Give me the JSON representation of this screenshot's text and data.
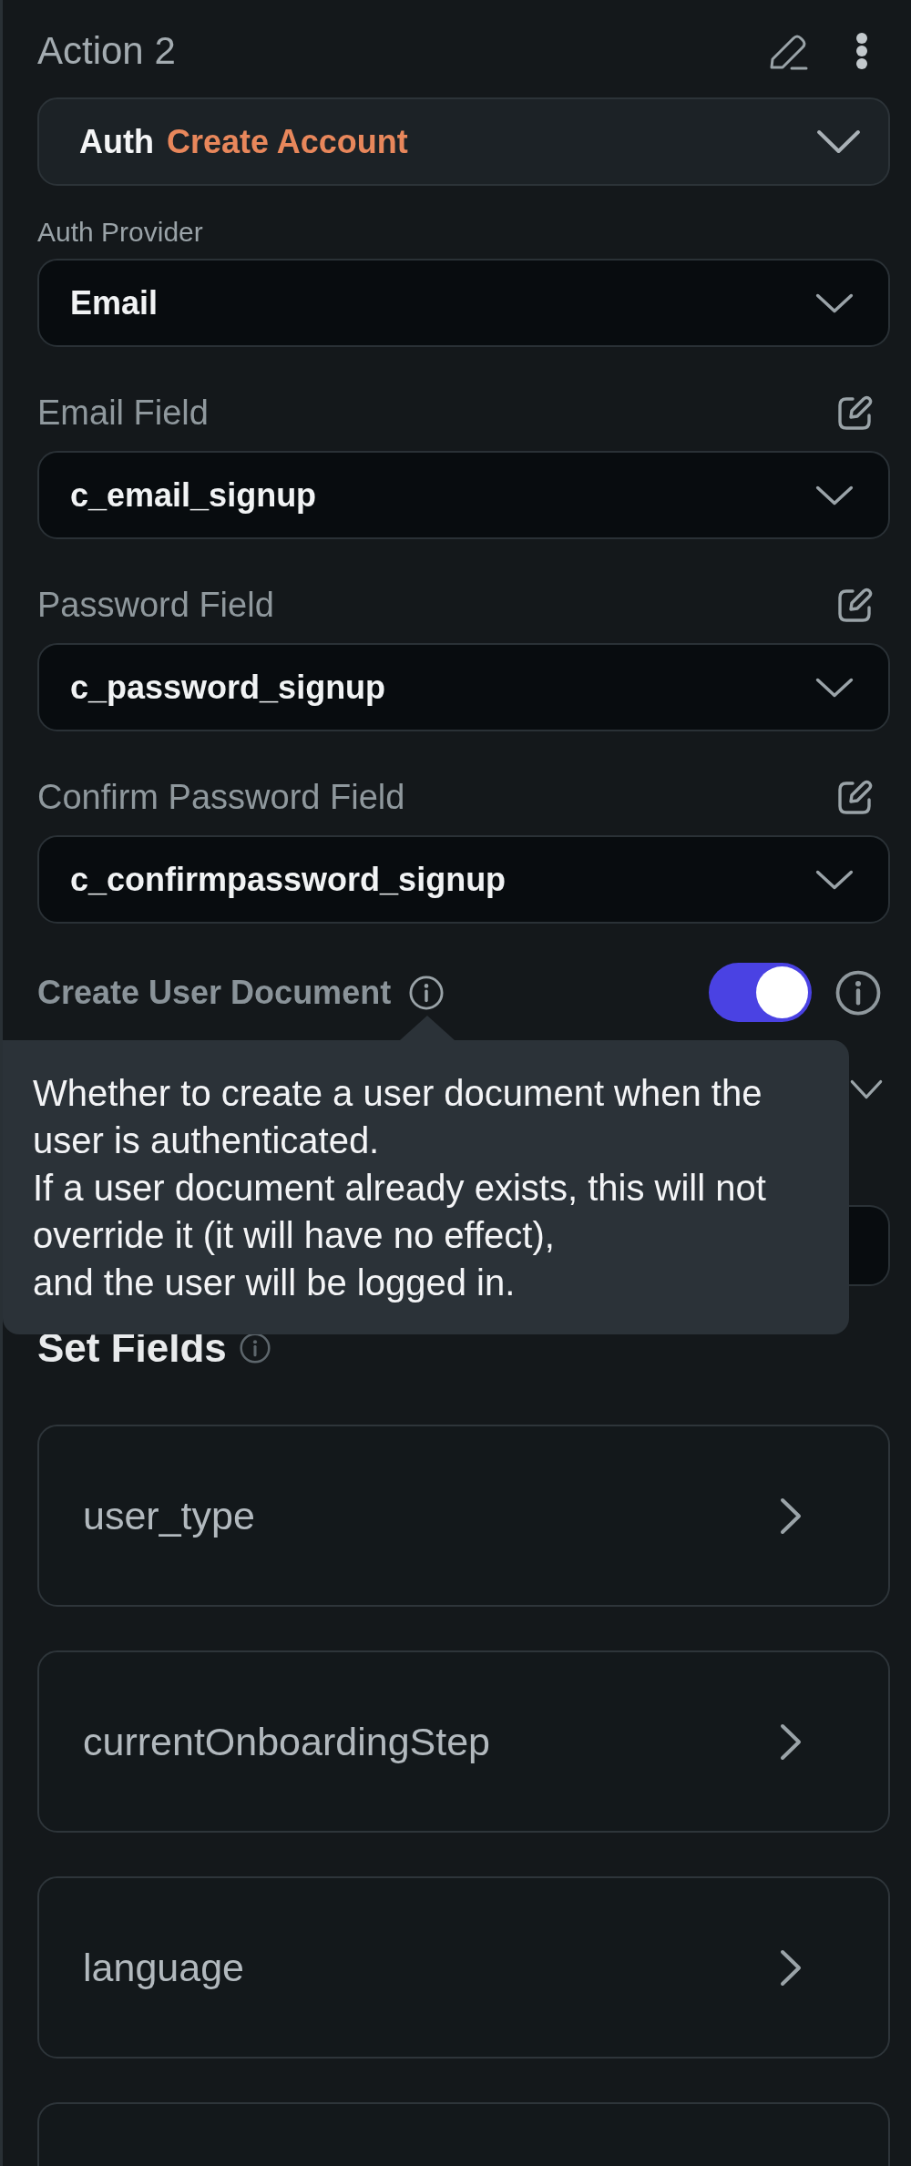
{
  "panel": {
    "title": "Action 2"
  },
  "action_select": {
    "category": "Auth",
    "action": "Create Account"
  },
  "auth_provider": {
    "label": "Auth Provider",
    "value": "Email"
  },
  "field_selects": [
    {
      "label": "Email Field",
      "value": "c_email_signup"
    },
    {
      "label": "Password Field",
      "value": "c_password_signup"
    },
    {
      "label": "Confirm Password Field",
      "value": "c_confirmpassword_signup"
    }
  ],
  "create_user_document": {
    "label": "Create User Document",
    "on": true
  },
  "tooltip": {
    "text": "Whether to create a user document when the user is authenticated.\nIf a user document already exists, this will not override it (it will have no effect),\nand the user will be logged in."
  },
  "set_fields": {
    "title": "Set Fields",
    "items": [
      {
        "name": "user_type"
      },
      {
        "name": "currentOnboardingStep"
      },
      {
        "name": "language"
      }
    ]
  }
}
